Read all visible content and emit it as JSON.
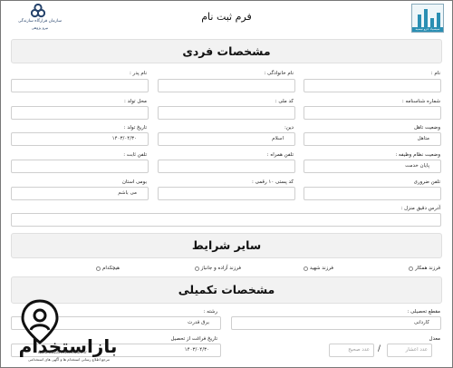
{
  "header": {
    "title": "فرم ثبت نام",
    "left_logo_line1": "سازمان قرارگاه سازندگی",
    "left_logo_line2": "نیرو پژوهی",
    "right_logo_caption": "سیسیاد جزو تیسیه"
  },
  "sections": {
    "personal": "مشخصات فردی",
    "other": "سایر شرایط",
    "extra": "مشخصات تکمیلی"
  },
  "personal": {
    "first_name_label": "نام :",
    "last_name_label": "نام خانوادگی :",
    "father_name_label": "نام پدر :",
    "id_number_label": "شماره شناسنامه :",
    "national_code_label": "کد ملی :",
    "birth_place_label": "محل تولد :",
    "marital_label": "وضعیت تاهل",
    "marital_value": "متاهل",
    "religion_label": "دین:",
    "religion_value": "اسلام",
    "birth_date_label": "تاریخ تولد :",
    "birth_date_value": "۱۴۰۳/۰۴/۳۰",
    "military_label": "وضعیت نظام وظیفه :",
    "military_value": "پایان خدمت",
    "mobile_label": "تلفن همراه :",
    "phone_label": "تلفن ثابت :",
    "emergency_phone_label": "تلفن ضروری",
    "postal_code_label": "کد پستی ۱۰ رقمی :",
    "native_label": "بومی استان",
    "native_value": "می باشم",
    "address_label": "آدرس دقیق منزل :"
  },
  "other": {
    "options": [
      "فرزند همکار",
      "فرزند شهید",
      "فرزند آزاده و جانباز",
      "هیچکدام"
    ]
  },
  "extra": {
    "degree_label": "مقطع تحصیلی :",
    "degree_value": "کاردانی",
    "field_label": "رشته :",
    "field_value": "برق قدرت",
    "average_label": "معدل",
    "average_decimal_placeholder": "عدد اعشار",
    "average_int_placeholder": "عدد صحیح",
    "grad_date_label": "تاریخ فراغت از تحصیل",
    "grad_date_value": "۱۴۰۳/۰۴/۳۰"
  },
  "watermark": {
    "text": "بازاستخدام",
    "url": "www.bazarestekhdam.ir",
    "sub": "مرجع اطلاع رسانی استخدام ها و آگهی های استخدامی"
  },
  "colors": {
    "section_bg": "#f2f2f2",
    "logo_blue": "#26436b",
    "logo_teal": "#2a8fb3"
  }
}
